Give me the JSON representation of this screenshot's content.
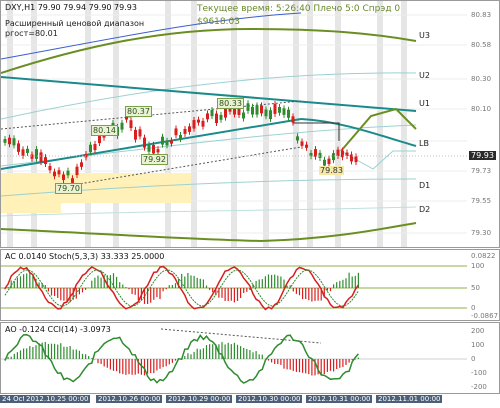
{
  "header": {
    "symbol_line": "DXY,H1  79.90 79.94 79.90 79.93",
    "indicator_label": "Расширенный ценовой диапазон",
    "indicator_value": "ргост=80.01",
    "server_time": "Текущее время: 5:26:40  Плечо 5:0  Спрэд 0",
    "balance": "$9618.03"
  },
  "price_tags": [
    "80.37",
    "80.33",
    "80.14",
    "79.92",
    "79.70",
    "79.83"
  ],
  "levels": [
    "U3",
    "U2",
    "U1",
    "LB",
    "D1",
    "D2"
  ],
  "price_axis": [
    "80.83",
    "80.58",
    "80.30",
    "80.10",
    "79.93",
    "79.73",
    "79.55",
    "79.30"
  ],
  "current_price": "79.93",
  "stoch_panel": {
    "label": "AC 0.0140  Stoch(5,3,3) 33.333  25.0000",
    "axis": [
      "0.0822",
      "100",
      "50",
      "0",
      "-0.0867"
    ]
  },
  "cci_panel": {
    "label": "AO -0.124  CCI(14) -3.0973",
    "axis": [
      "200",
      "100",
      "0",
      "-100",
      "-200"
    ]
  },
  "time_axis": [
    "24 Oct",
    "2012.10.25 00:00",
    "2012.10.26 00:00",
    "2012.10.29 00:00",
    "2012.10.30 00:00",
    "2012.10.31 00:00",
    "2012.11.01 00:00"
  ],
  "colors": {
    "bull": "#2e8b2e",
    "bear": "#d81e1e",
    "channel": "#1b8a8a",
    "envelope": "#6b8e23",
    "zone": "#fff1b8",
    "stoch_main": "#d81e1e",
    "stoch_signal": "#2e8b2e"
  }
}
